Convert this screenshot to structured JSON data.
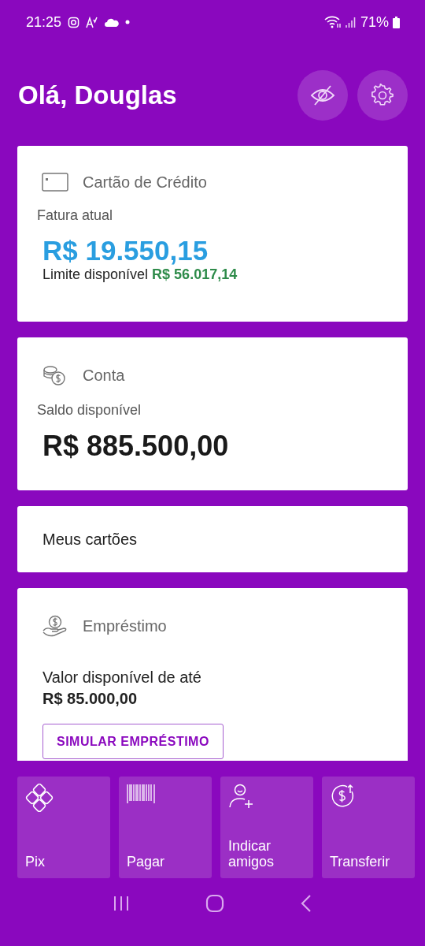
{
  "status_bar": {
    "time": "21:25",
    "battery": "71%"
  },
  "header": {
    "greeting": "Olá, Douglas"
  },
  "cards": [
    {
      "kind": "credit",
      "title": "Cartão de Crédito",
      "label": "Fatura atual",
      "amount": "R$ 19.550,15",
      "limit_label": "Limite disponível",
      "limit_value": "R$ 56.017,14"
    },
    {
      "kind": "account",
      "title": "Conta",
      "label": "Saldo disponível",
      "amount": "R$ 885.500,00"
    },
    {
      "kind": "link",
      "title": "Meus cartões"
    },
    {
      "kind": "loan",
      "title": "Empréstimo",
      "label": "Valor disponível de até",
      "amount": "R$ 85.000,00",
      "button": "SIMULAR EMPRÉSTIMO"
    }
  ],
  "shortcuts": [
    {
      "kind": "pix",
      "label": "Pix"
    },
    {
      "kind": "pay",
      "label": "Pagar"
    },
    {
      "kind": "invite",
      "label": "Indicar amigos"
    },
    {
      "kind": "transfer",
      "label": "Transferir"
    }
  ]
}
